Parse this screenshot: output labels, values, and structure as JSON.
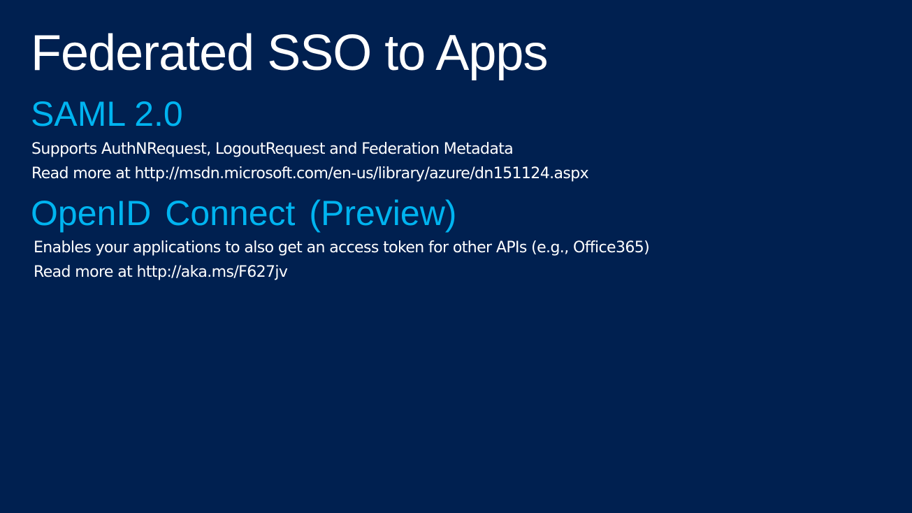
{
  "colors": {
    "background": "#002050",
    "title_text": "#ffffff",
    "heading_accent": "#00b4f0",
    "body_text": "#ffffff"
  },
  "slide": {
    "title": "Federated SSO to Apps",
    "sections": [
      {
        "heading": "SAML 2.0",
        "lines": [
          "Supports AuthNRequest, LogoutRequest and Federation Metadata",
          "Read more at http://msdn.microsoft.com/en-us/library/azure/dn151124.aspx"
        ]
      },
      {
        "heading": "OpenID Connect (Preview)",
        "lines": [
          "Enables your applications to also get an access token for other APIs (e.g., Office365)",
          "Read more at http://aka.ms/F627jv"
        ]
      }
    ]
  }
}
